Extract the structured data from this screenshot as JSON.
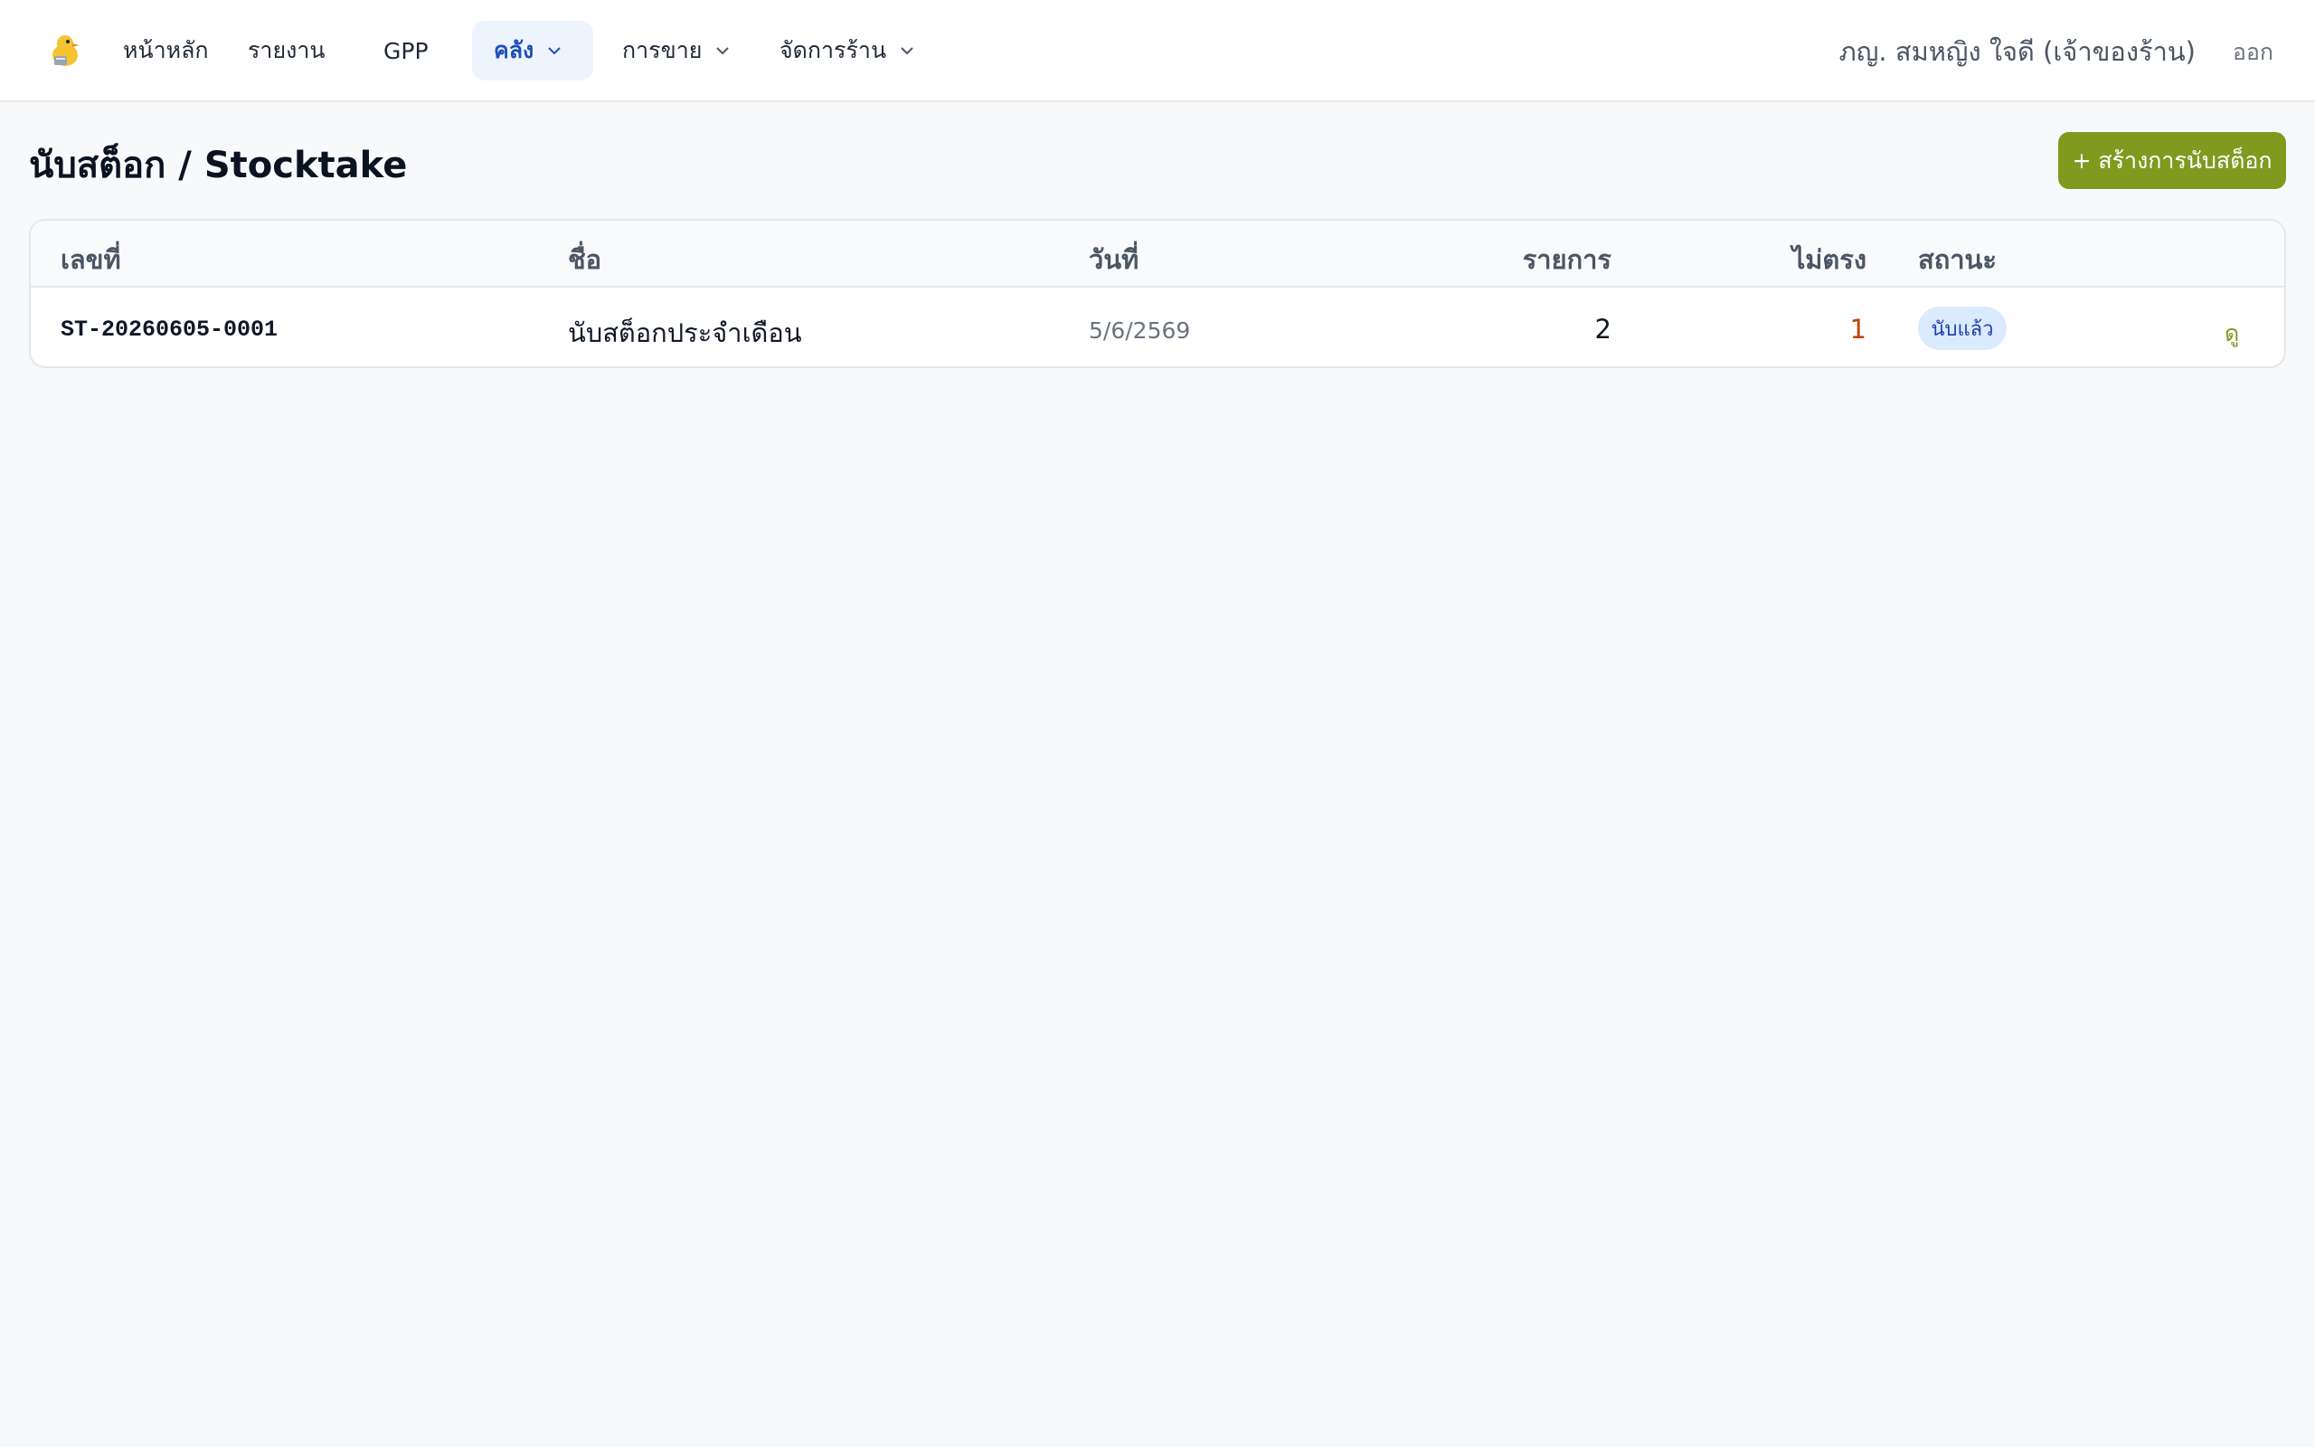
{
  "nav": {
    "items": [
      {
        "label": "หน้าหลัก"
      },
      {
        "label": "รายงาน"
      },
      {
        "label": "GPP"
      },
      {
        "label": "คลัง"
      },
      {
        "label": "การขาย"
      },
      {
        "label": "จัดการร้าน"
      }
    ],
    "active_index": 3,
    "user_name": "ภญ. สมหญิง ใจดี (เจ้าของร้าน)",
    "logout_label": "ออก"
  },
  "page": {
    "title": "นับสต็อก / Stocktake",
    "create_button_label": "+ สร้างการนับสต็อก"
  },
  "table": {
    "columns": [
      "เลขที่",
      "ชื่อ",
      "วันที่",
      "รายการ",
      "ไม่ตรง",
      "สถานะ"
    ],
    "rows": [
      {
        "number": "ST-20260605-0001",
        "name": "นับสต็อกประจำเดือน",
        "date": "5/6/2569",
        "items": "2",
        "mismatch": "1",
        "status": "นับแล้ว",
        "action": "ดู"
      }
    ]
  },
  "colors": {
    "accent": "#7f9a1f",
    "active_nav": "#1d4fb8",
    "mismatch": "#c2410c",
    "badge_bg": "#dbeafe"
  },
  "icons": [
    "duck-logo-icon",
    "chevron-down-icon"
  ]
}
